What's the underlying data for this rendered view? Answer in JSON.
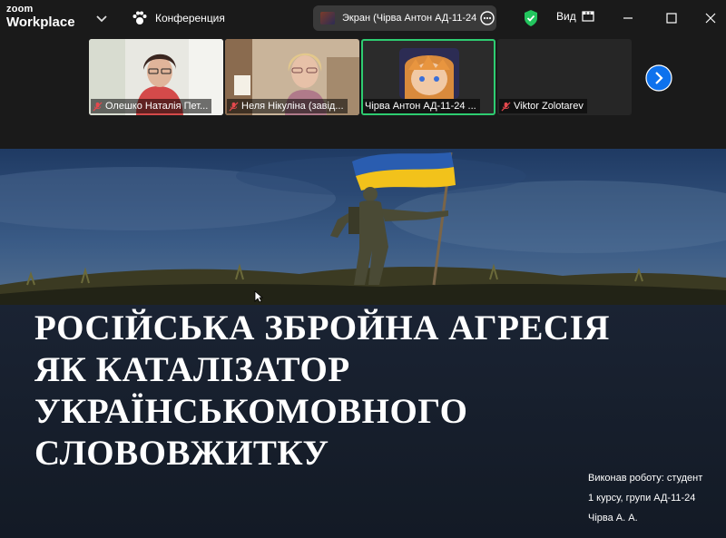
{
  "app": {
    "logo_line1": "zoom",
    "logo_line2": "Workplace",
    "meeting_label": "Конференция"
  },
  "share": {
    "label": "Экран (Чірва Антон АД-11-24)"
  },
  "toolbar": {
    "view_label": "Вид"
  },
  "participants": [
    {
      "name": "Олешко Наталія Пет...",
      "muted": true
    },
    {
      "name": "Неля Нікуліна (завід...",
      "muted": true
    },
    {
      "name": "Чірва Антон АД-11-24 ...",
      "muted": false
    },
    {
      "name": "Viktor Zolotarev",
      "muted": true
    }
  ],
  "slide": {
    "title_lines": [
      "РОСІЙСЬКА ЗБРОЙНА АГРЕСІЯ",
      "ЯК КАТАЛІЗАТОР",
      "УКРАЇНСЬКОМОВНОГО",
      "СЛОВОВЖИТКУ"
    ],
    "author_lines": [
      "Виконав роботу: студент",
      "1 курсу, групи АД-11-24",
      "Чірва А. А."
    ]
  },
  "colors": {
    "accent_green": "#2ecc71",
    "mute_red": "#e5484d",
    "next_blue": "#0e72ed",
    "flag_blue": "#2a5db0",
    "flag_yellow": "#f2c21b"
  }
}
